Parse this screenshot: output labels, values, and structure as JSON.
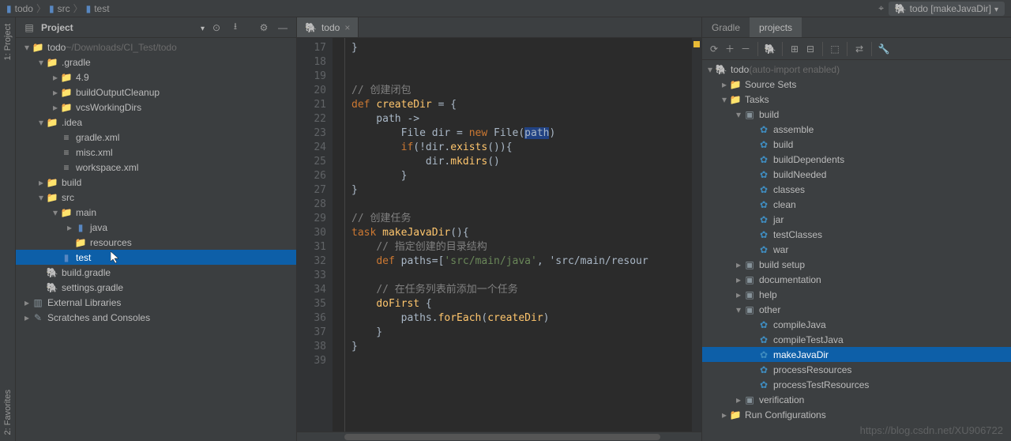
{
  "breadcrumb": [
    "todo",
    "src",
    "test"
  ],
  "run_config": "todo [makeJavaDir]",
  "vtabs": {
    "project": "1: Project",
    "favorites": "2: Favorites"
  },
  "project_panel": {
    "title": "Project",
    "root_name": "todo",
    "root_path": "~/Downloads/CI_Test/todo",
    "tree": [
      {
        "d": 0,
        "tw": "open",
        "ico": "folder-mod",
        "label": "todo",
        "suffix": "~/Downloads/CI_Test/todo"
      },
      {
        "d": 1,
        "tw": "open",
        "ico": "folder",
        "label": ".gradle"
      },
      {
        "d": 2,
        "tw": "closed",
        "ico": "folder",
        "label": "4.9"
      },
      {
        "d": 2,
        "tw": "closed",
        "ico": "folder",
        "label": "buildOutputCleanup"
      },
      {
        "d": 2,
        "tw": "closed",
        "ico": "folder",
        "label": "vcsWorkingDirs"
      },
      {
        "d": 1,
        "tw": "open",
        "ico": "folder",
        "label": ".idea"
      },
      {
        "d": 2,
        "tw": "",
        "ico": "file",
        "label": "gradle.xml"
      },
      {
        "d": 2,
        "tw": "",
        "ico": "file",
        "label": "misc.xml"
      },
      {
        "d": 2,
        "tw": "",
        "ico": "file",
        "label": "workspace.xml"
      },
      {
        "d": 1,
        "tw": "closed",
        "ico": "folder-mod",
        "label": "build"
      },
      {
        "d": 1,
        "tw": "open",
        "ico": "folder",
        "label": "src"
      },
      {
        "d": 2,
        "tw": "open",
        "ico": "folder",
        "label": "main"
      },
      {
        "d": 3,
        "tw": "closed",
        "ico": "src",
        "label": "java"
      },
      {
        "d": 3,
        "tw": "",
        "ico": "folder-mod",
        "label": "resources"
      },
      {
        "d": 2,
        "tw": "",
        "ico": "src",
        "label": "test",
        "selected": true
      },
      {
        "d": 1,
        "tw": "",
        "ico": "gradle",
        "label": "build.gradle"
      },
      {
        "d": 1,
        "tw": "",
        "ico": "gradle",
        "label": "settings.gradle"
      },
      {
        "d": 0,
        "tw": "closed",
        "ico": "lib",
        "label": "External Libraries"
      },
      {
        "d": 0,
        "tw": "closed",
        "ico": "scratch",
        "label": "Scratches and Consoles"
      }
    ]
  },
  "editor": {
    "tab_label": "todo",
    "first_line": 17,
    "lines": [
      "}",
      "",
      "",
      "// 创建闭包",
      "def createDir = {",
      "    path ->",
      "        File dir = new File(path)",
      "        if(!dir.exists()){",
      "            dir.mkdirs()",
      "        }",
      "}",
      "",
      "// 创建任务",
      "task makeJavaDir(){",
      "    // 指定创建的目录结构",
      "    def paths=['src/main/java', 'src/main/resour",
      "",
      "    // 在任务列表前添加一个任务",
      "    doFirst {",
      "        paths.forEach(createDir)",
      "    }",
      "}",
      ""
    ]
  },
  "gradle_panel": {
    "tabs": [
      "Gradle",
      "projects"
    ],
    "root": "todo",
    "root_suffix": "(auto-import enabled)",
    "tree": [
      {
        "d": 0,
        "tw": "open",
        "ico": "gradle",
        "label": "todo",
        "suffix": "(auto-import enabled)"
      },
      {
        "d": 1,
        "tw": "closed",
        "ico": "folder",
        "label": "Source Sets"
      },
      {
        "d": 1,
        "tw": "open",
        "ico": "folder",
        "label": "Tasks"
      },
      {
        "d": 2,
        "tw": "open",
        "ico": "taskgroup",
        "label": "build"
      },
      {
        "d": 3,
        "tw": "",
        "ico": "task",
        "label": "assemble"
      },
      {
        "d": 3,
        "tw": "",
        "ico": "task",
        "label": "build"
      },
      {
        "d": 3,
        "tw": "",
        "ico": "task",
        "label": "buildDependents"
      },
      {
        "d": 3,
        "tw": "",
        "ico": "task",
        "label": "buildNeeded"
      },
      {
        "d": 3,
        "tw": "",
        "ico": "task",
        "label": "classes"
      },
      {
        "d": 3,
        "tw": "",
        "ico": "task",
        "label": "clean"
      },
      {
        "d": 3,
        "tw": "",
        "ico": "task",
        "label": "jar"
      },
      {
        "d": 3,
        "tw": "",
        "ico": "task",
        "label": "testClasses"
      },
      {
        "d": 3,
        "tw": "",
        "ico": "task",
        "label": "war"
      },
      {
        "d": 2,
        "tw": "closed",
        "ico": "taskgroup",
        "label": "build setup"
      },
      {
        "d": 2,
        "tw": "closed",
        "ico": "taskgroup",
        "label": "documentation"
      },
      {
        "d": 2,
        "tw": "closed",
        "ico": "taskgroup",
        "label": "help"
      },
      {
        "d": 2,
        "tw": "open",
        "ico": "taskgroup",
        "label": "other"
      },
      {
        "d": 3,
        "tw": "",
        "ico": "task",
        "label": "compileJava"
      },
      {
        "d": 3,
        "tw": "",
        "ico": "task",
        "label": "compileTestJava"
      },
      {
        "d": 3,
        "tw": "",
        "ico": "task",
        "label": "makeJavaDir",
        "selected": true
      },
      {
        "d": 3,
        "tw": "",
        "ico": "task",
        "label": "processResources"
      },
      {
        "d": 3,
        "tw": "",
        "ico": "task",
        "label": "processTestResources"
      },
      {
        "d": 2,
        "tw": "closed",
        "ico": "taskgroup",
        "label": "verification"
      },
      {
        "d": 1,
        "tw": "closed",
        "ico": "folder",
        "label": "Run Configurations"
      }
    ]
  },
  "watermark": "https://blog.csdn.net/XU906722"
}
